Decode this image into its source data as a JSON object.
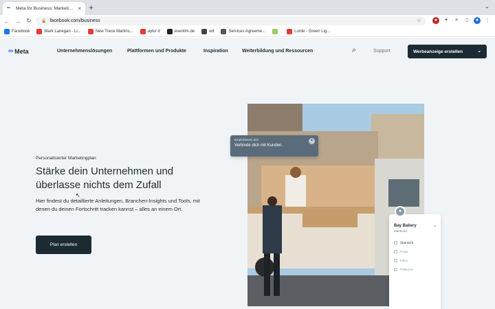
{
  "browser": {
    "tab_title": "Meta for Business: Marketing ...",
    "tab_close": "×",
    "new_tab": "+",
    "tab_menu": "⌄",
    "url": "facebook.com/business",
    "nav": {
      "back": "←",
      "forward": "→",
      "reload": "↻"
    }
  },
  "bookmarks": [
    {
      "label": "Facebook",
      "color": "#1877f2"
    },
    {
      "label": "Mark Lanegan - Li...",
      "color": "#e53935"
    },
    {
      "label": "New Trece Martins...",
      "color": "#e53935"
    },
    {
      "label": "aylor d",
      "color": "#e53935"
    },
    {
      "label": "eventim.de",
      "color": "#222222"
    },
    {
      "label": "wit",
      "color": "#444444"
    },
    {
      "label": "Services Agreeme...",
      "color": "#555555"
    },
    {
      "label": "",
      "color": "#9ccc65"
    },
    {
      "label": "Lorde - Green Lig...",
      "color": "#e53935"
    }
  ],
  "site": {
    "logo": "Meta",
    "nav": [
      "Unternehmenslösungen",
      "Plattformen und Produkte",
      "Inspiration",
      "Weiterbildung und Ressourcen"
    ],
    "support": "Support",
    "create_ad": "Werbeanzeige erstellen"
  },
  "hero": {
    "eyebrow": "Personalisierter Marketingplan",
    "title": "Stärke dein Unternehmen und überlasse nichts dem Zufall",
    "body": "Hier findest du detaillierte Anleitungen, Branchen-Insights und Tools, mit denen du deinen Fortschritt tracken kannst – alles an einem Ort.",
    "button": "Plan erstellen"
  },
  "overlay_chat": {
    "label": "Empfohlenes Ziel",
    "text": "Verbinde dich mit Kunden."
  },
  "overlay_business": {
    "name": "Bay Bakery",
    "sub": "Manhood",
    "menu": [
      "Übersicht",
      "Posts",
      "Inbox",
      "Präferenz"
    ]
  },
  "colors": {
    "page_bg": "#f1f4f7",
    "dark_button": "#1c2b33",
    "meta_blue": "#0866ff"
  }
}
